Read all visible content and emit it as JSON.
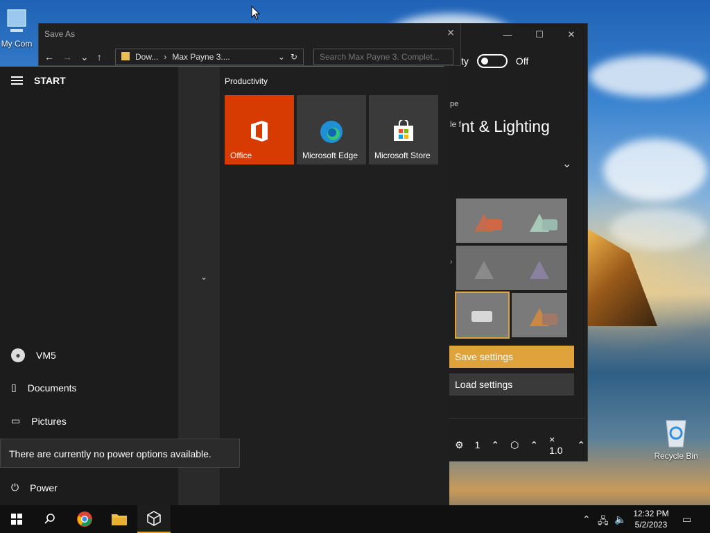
{
  "desktop": {
    "icon_my_computer": "My Com",
    "icon_recycle_bin": "Recycle Bin"
  },
  "save_as": {
    "title": "Save As",
    "path_part1": "Dow...",
    "path_part2": "Max Payne 3....",
    "search_placeholder": "Search Max Payne 3. Complet..."
  },
  "lighting": {
    "toggle_label": "ty",
    "toggle_state": "Off",
    "side_label1": "pe",
    "side_label2": "le f",
    "heading": "nt & Lighting",
    "save_settings": "Save settings",
    "load_settings": "Load settings",
    "footer_count1": "1",
    "footer_zoom": "× 1.0"
  },
  "start": {
    "title": "START",
    "user": "VM5",
    "documents": "Documents",
    "pictures": "Pictures",
    "power": "Power",
    "power_tooltip": "There are currently no power options available.",
    "group_label": "Productivity",
    "tiles": [
      "Office",
      "Microsoft Edge",
      "Microsoft Store"
    ]
  },
  "taskbar": {
    "time": "12:32 PM",
    "date": "5/2/2023"
  },
  "colors": {
    "accent": "#e0a23a",
    "office": "#d83b01"
  }
}
